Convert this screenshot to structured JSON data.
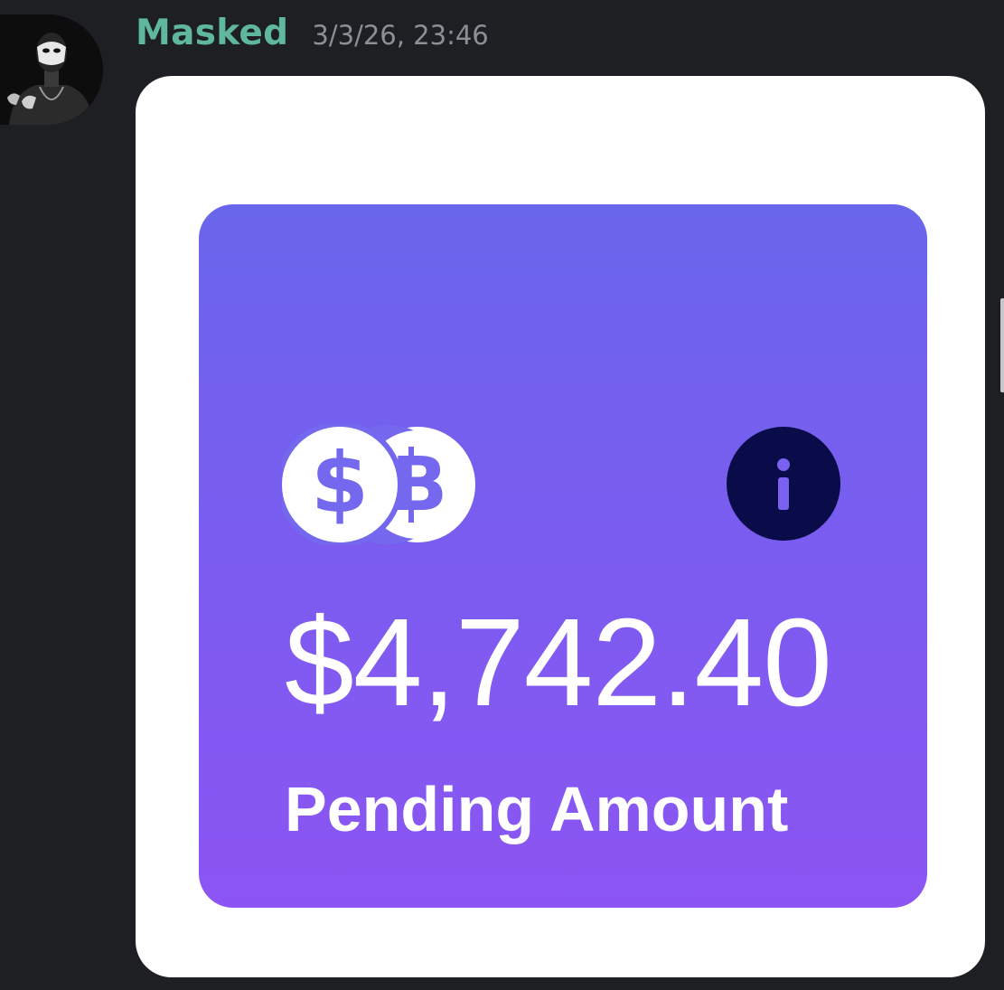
{
  "message": {
    "author": "Masked",
    "timestamp": "3/3/26, 23:46",
    "author_color": "#5fb89b",
    "avatar": "masked-man-avatar"
  },
  "card": {
    "amount": "$4,742.40",
    "label": "Pending Amount",
    "icons": [
      "dollar-bitcoin-coins-icon",
      "info-icon"
    ],
    "gradient_top": "#6a66ec",
    "gradient_bottom": "#8c55f3",
    "info_button_color": "#0a0c4a"
  }
}
